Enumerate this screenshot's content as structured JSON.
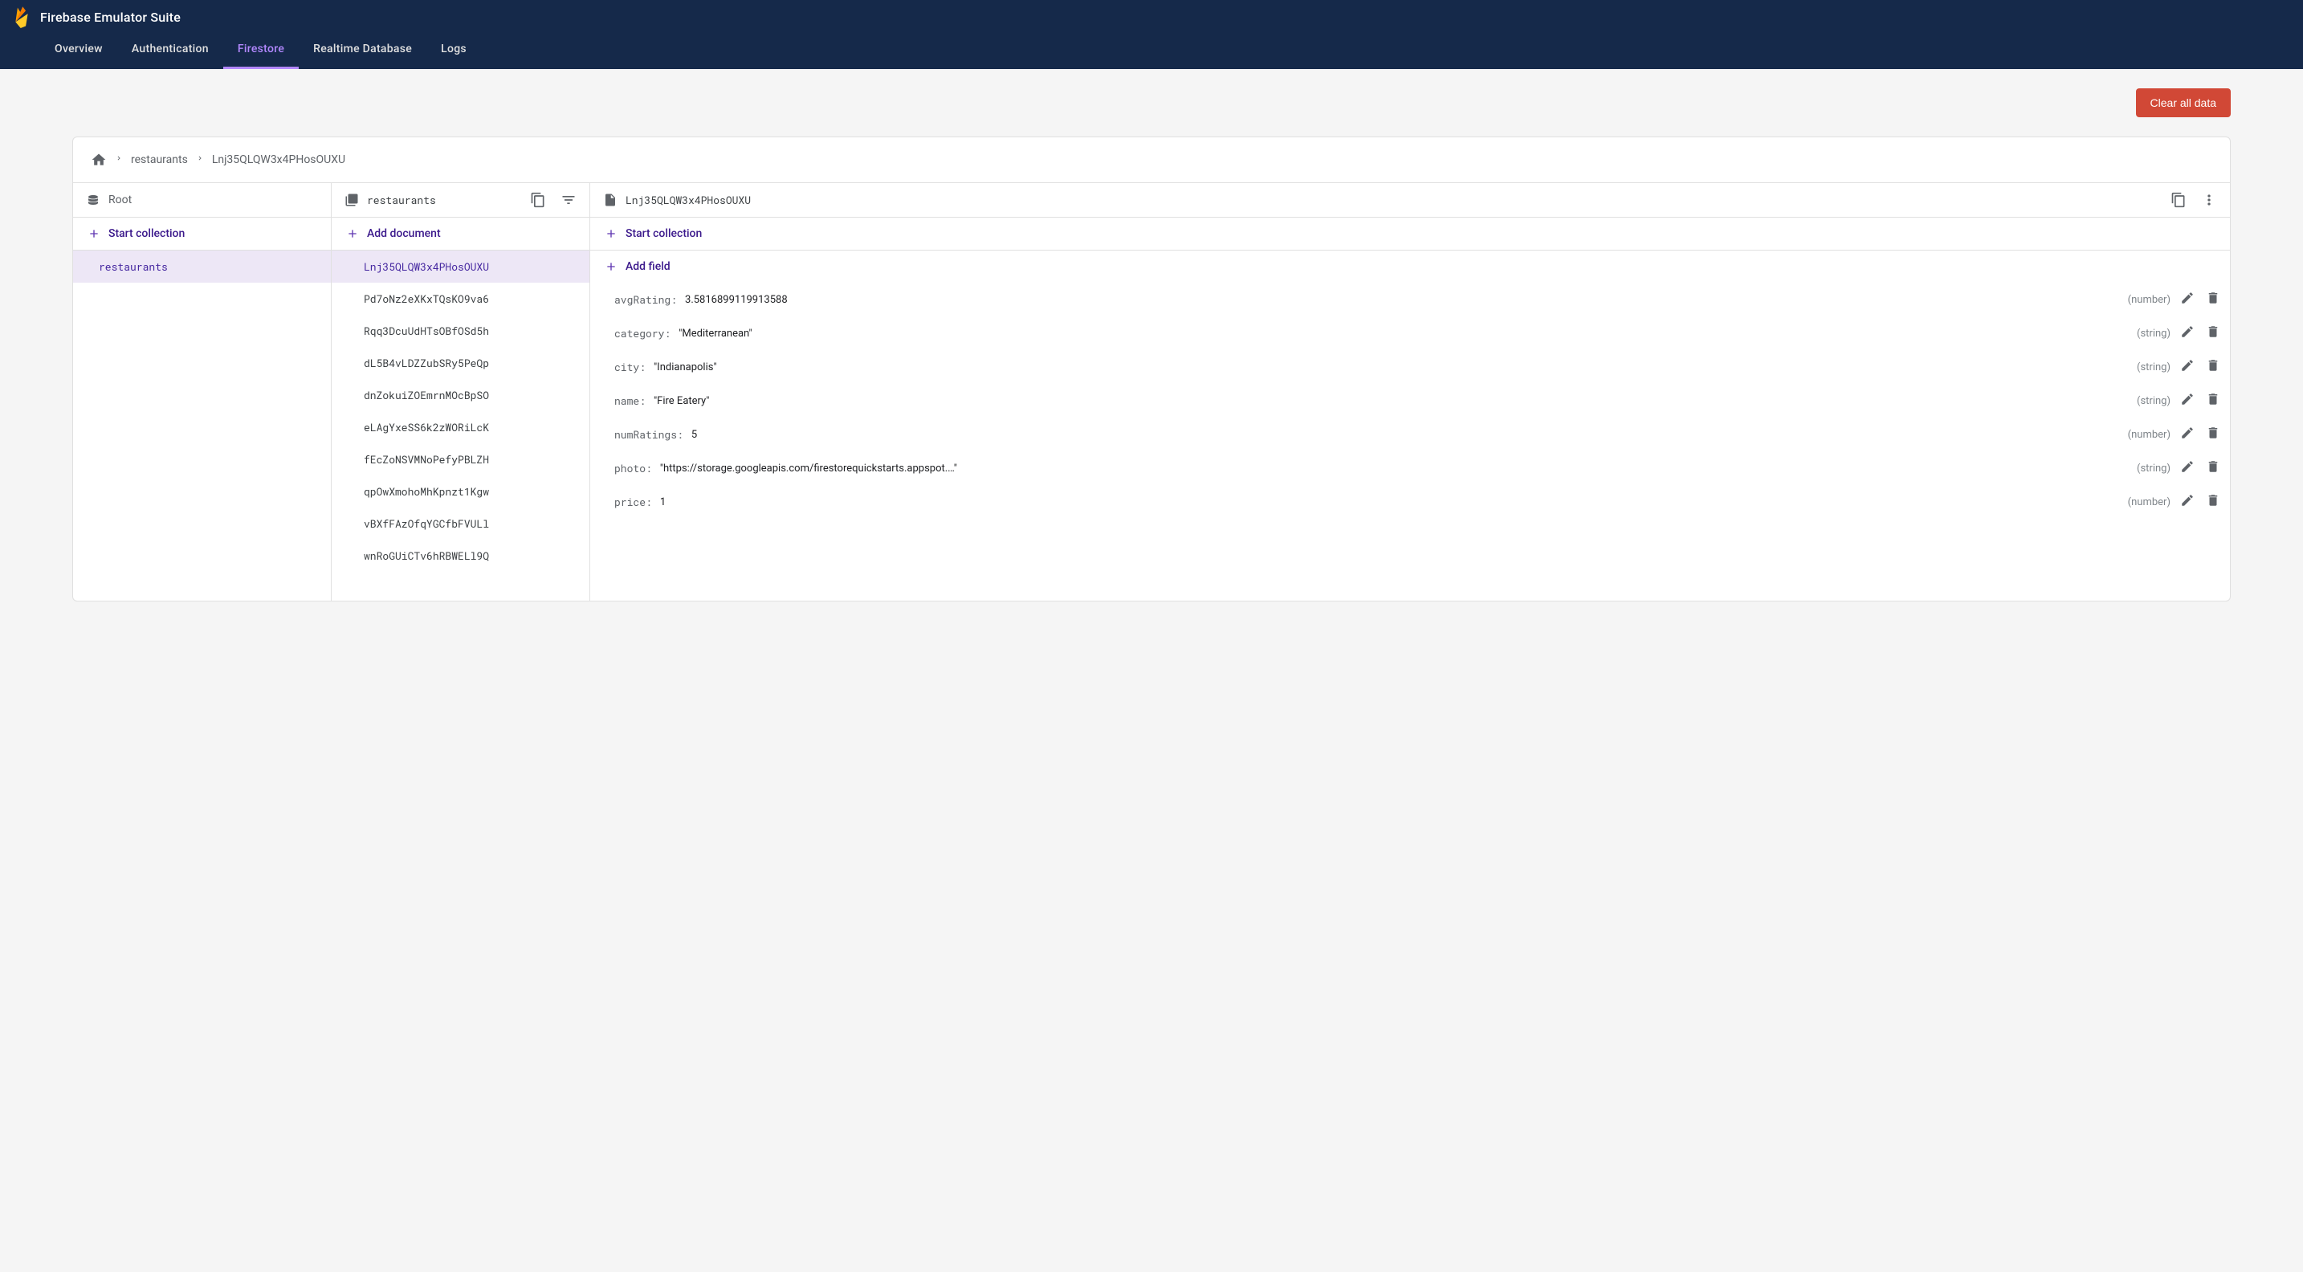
{
  "header": {
    "title": "Firebase Emulator Suite",
    "tabs": [
      "Overview",
      "Authentication",
      "Firestore",
      "Realtime Database",
      "Logs"
    ],
    "active_tab_index": 2
  },
  "toolbar": {
    "clear_label": "Clear all data"
  },
  "breadcrumb": {
    "parts": [
      "restaurants",
      "Lnj35QLQW3x4PHosOUXU"
    ]
  },
  "col_root": {
    "header": "Root",
    "action": "Start collection",
    "items": [
      "restaurants"
    ],
    "selected_index": 0
  },
  "col_docs": {
    "header": "restaurants",
    "action": "Add document",
    "items": [
      "Lnj35QLQW3x4PHosOUXU",
      "Pd7oNz2eXKxTQsKO9va6",
      "Rqq3DcuUdHTsOBfOSd5h",
      "dL5B4vLDZZubSRy5PeQp",
      "dnZokuiZOEmrnMOcBpSO",
      "eLAgYxeSS6k2zWORiLcK",
      "fEcZoNSVMNoPefyPBLZH",
      "qpOwXmohoMhKpnzt1Kgw",
      "vBXfFAzOfqYGCfbFVULl",
      "wnRoGUiCTv6hRBWELl9Q"
    ],
    "selected_index": 0
  },
  "col_fields": {
    "header": "Lnj35QLQW3x4PHosOUXU",
    "action_collection": "Start collection",
    "action_field": "Add field",
    "fields": [
      {
        "key": "avgRating",
        "value": "3.5816899119913588",
        "type": "number",
        "quoted": false
      },
      {
        "key": "category",
        "value": "Mediterranean",
        "type": "string",
        "quoted": true
      },
      {
        "key": "city",
        "value": "Indianapolis",
        "type": "string",
        "quoted": true
      },
      {
        "key": "name",
        "value": "Fire Eatery",
        "type": "string",
        "quoted": true
      },
      {
        "key": "numRatings",
        "value": "5",
        "type": "number",
        "quoted": false
      },
      {
        "key": "photo",
        "value": "https://storage.googleapis.com/firestorequickstarts.appspot.…",
        "type": "string",
        "quoted": true
      },
      {
        "key": "price",
        "value": "1",
        "type": "number",
        "quoted": false
      }
    ]
  }
}
